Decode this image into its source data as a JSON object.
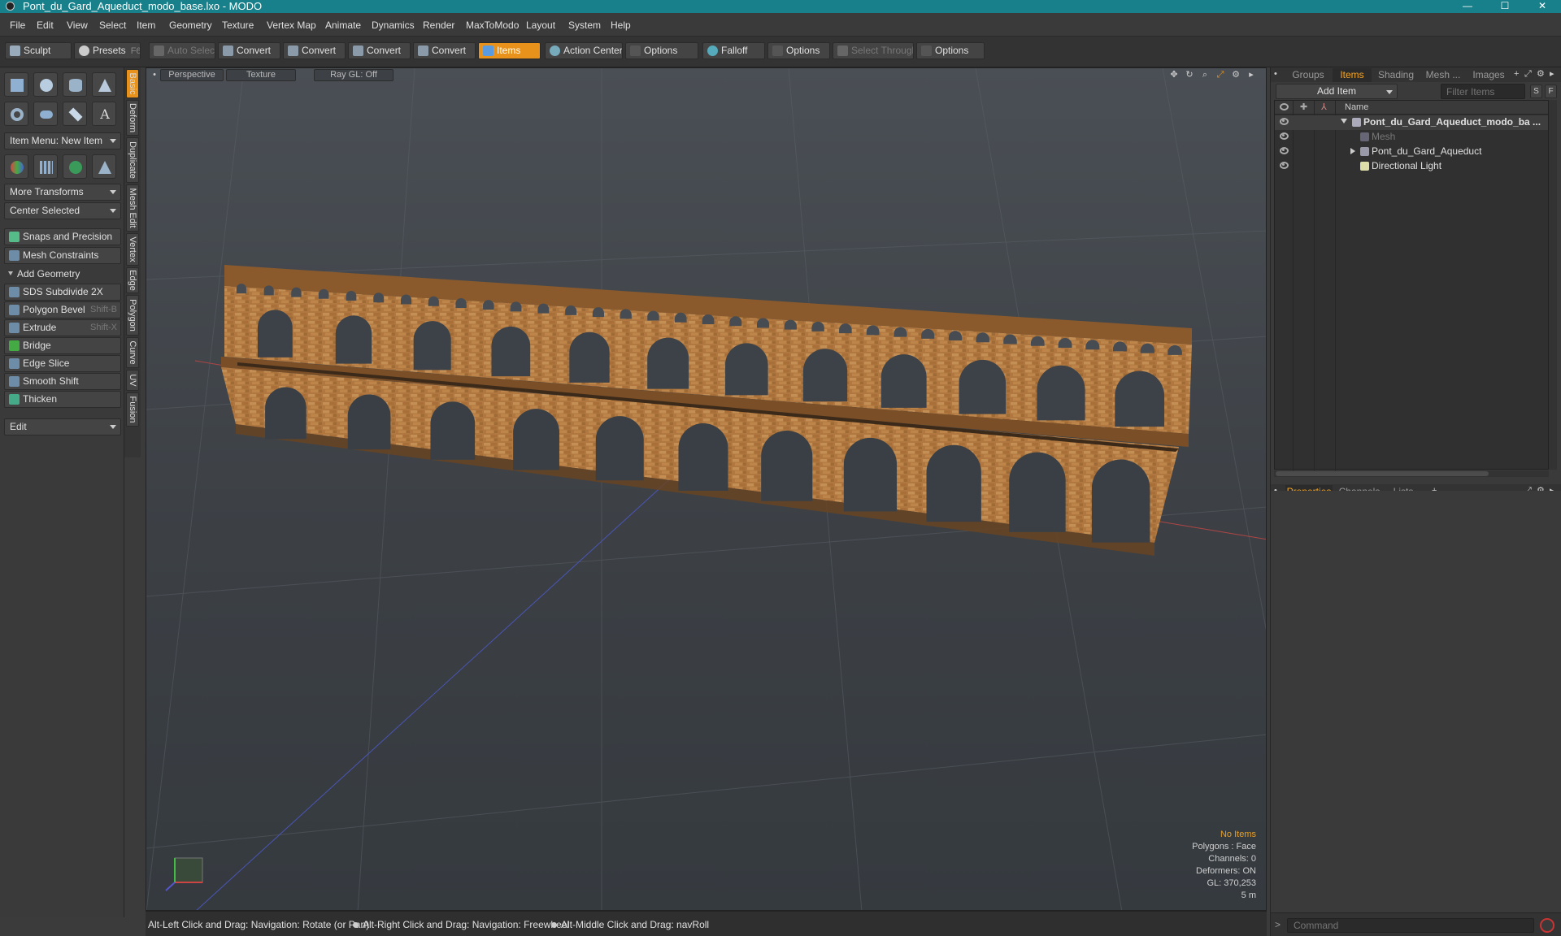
{
  "window": {
    "title": "Pont_du_Gard_Aqueduct_modo_base.lxo - MODO",
    "minimize": "—",
    "maximize": "☐",
    "close": "✕"
  },
  "menu": [
    "File",
    "Edit",
    "View",
    "Select",
    "Item",
    "Geometry",
    "Texture",
    "Vertex Map",
    "Animate",
    "Dynamics",
    "Render",
    "MaxToModo",
    "Layout",
    "System",
    "Help"
  ],
  "toolbar": {
    "sculpt": "Sculpt",
    "presets": "Presets",
    "presets_key": "F6",
    "auto_select": "Auto Select",
    "convert": "Convert",
    "items": "Items",
    "action_center": "Action Center",
    "options": "Options",
    "falloff": "Falloff",
    "select_through": "Select Through"
  },
  "left_panel": {
    "item_menu": "Item Menu: New Item",
    "more_transforms": "More Transforms",
    "center_selected": "Center Selected",
    "snaps": "Snaps and Precision",
    "mesh_constraints": "Mesh Constraints",
    "add_geometry": "Add Geometry",
    "tools": [
      {
        "label": "SDS Subdivide 2X",
        "shortcut": ""
      },
      {
        "label": "Polygon Bevel",
        "shortcut": "Shift-B"
      },
      {
        "label": "Extrude",
        "shortcut": "Shift-X"
      },
      {
        "label": "Bridge",
        "shortcut": ""
      },
      {
        "label": "Edge Slice",
        "shortcut": ""
      },
      {
        "label": "Smooth Shift",
        "shortcut": ""
      },
      {
        "label": "Thicken",
        "shortcut": ""
      }
    ],
    "edit": "Edit"
  },
  "vertical_tabs": [
    "Basic",
    "Deform",
    "Duplicate",
    "Mesh Edit",
    "Vertex",
    "Edge",
    "Polygon",
    "Curve",
    "UV",
    "Fusion"
  ],
  "viewport": {
    "view": "Perspective",
    "shading": "Texture",
    "raygl": "Ray GL: Off",
    "icons": {
      "move": "✥",
      "rotate": "↻",
      "zoom": "⌕",
      "maximize": "⤢",
      "settings": "⚙",
      "arrow": "▸"
    },
    "info": [
      "No Items",
      "Polygons : Face",
      "Channels: 0",
      "Deformers: ON",
      "GL: 370,253",
      "5 m"
    ]
  },
  "status": [
    "Alt-Left Click and Drag: Navigation: Rotate (or Pan)",
    "Alt-Right Click and Drag: Navigation: Freewheel",
    "Alt-Middle Click and Drag: navRoll"
  ],
  "right_panel": {
    "tabs": [
      "Groups",
      "Items",
      "Shading",
      "Mesh ...",
      "Images"
    ],
    "add_item": "Add Item",
    "filter_placeholder": "Filter Items",
    "btn_s": "S",
    "btn_f": "F",
    "name_col": "Name",
    "tree": [
      {
        "label": "Pont_du_Gard_Aqueduct_modo_ba ...",
        "bold": true
      },
      {
        "label": "Mesh",
        "dim": true
      },
      {
        "label": "Pont_du_Gard_Aqueduct"
      },
      {
        "label": "Directional Light"
      }
    ],
    "bottom_tabs": [
      "Properties",
      "Channels",
      "Lists"
    ],
    "plus": "+",
    "command_placeholder": "Command",
    "cmd_arrow": ">"
  }
}
